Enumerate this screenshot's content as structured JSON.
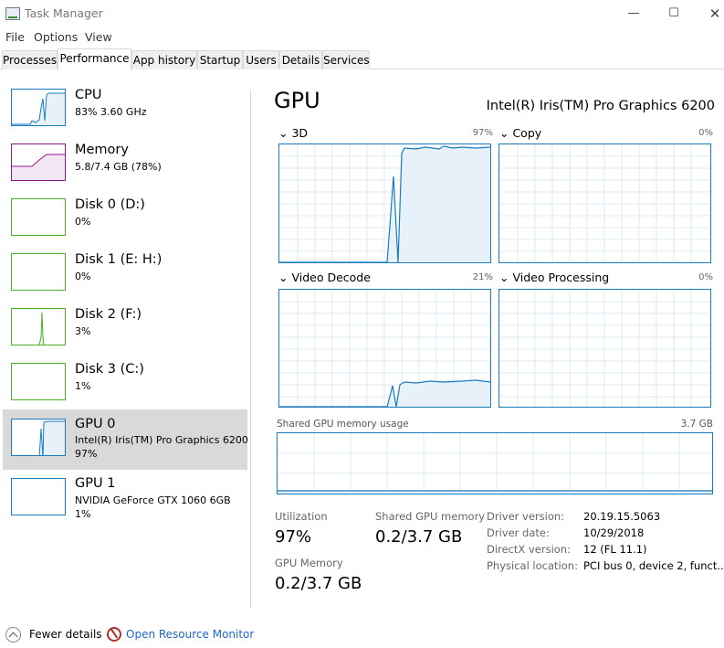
{
  "window": {
    "title": "Task Manager",
    "minimize": "—",
    "maximize": "☐",
    "close": "✕"
  },
  "menu": [
    "File",
    "Options",
    "View"
  ],
  "tabs": [
    "Processes",
    "Performance",
    "App history",
    "Startup",
    "Users",
    "Details",
    "Services"
  ],
  "active_tab": "Performance",
  "colors": {
    "cpu": "#1a7bbf",
    "memory": "#8b1a8b",
    "disk": "#4caf2a",
    "gpu": "#1a7bbf",
    "selected_bg": "#d9d9d9"
  },
  "sidebar": [
    {
      "name": "CPU",
      "sub1": "83% 3.60 GHz",
      "sub2": ""
    },
    {
      "name": "Memory",
      "sub1": "5.8/7.4 GB (78%)",
      "sub2": ""
    },
    {
      "name": "Disk 0 (D:)",
      "sub1": "0%",
      "sub2": ""
    },
    {
      "name": "Disk 1 (E: H:)",
      "sub1": "0%",
      "sub2": ""
    },
    {
      "name": "Disk 2 (F:)",
      "sub1": "3%",
      "sub2": ""
    },
    {
      "name": "Disk 3 (C:)",
      "sub1": "1%",
      "sub2": ""
    },
    {
      "name": "GPU 0",
      "sub1": "Intel(R) Iris(TM) Pro Graphics 6200",
      "sub2": "97%"
    },
    {
      "name": "GPU 1",
      "sub1": "NVIDIA GeForce GTX 1060 6GB",
      "sub2": "1%"
    }
  ],
  "selected_item": "GPU 0",
  "gpu": {
    "title": "GPU",
    "model": "Intel(R) Iris(TM) Pro Graphics 6200",
    "engines": [
      {
        "label": "3D",
        "pct": "97%"
      },
      {
        "label": "Copy",
        "pct": "0%"
      },
      {
        "label": "Video Decode",
        "pct": "21%"
      },
      {
        "label": "Video Processing",
        "pct": "0%"
      }
    ],
    "shared_memory_label": "Shared GPU memory usage",
    "shared_memory_max": "3.7 GB",
    "stats": {
      "utilization_label": "Utilization",
      "utilization": "97%",
      "shared_label": "Shared GPU memory",
      "shared": "0.2/3.7 GB",
      "gpu_memory_label": "GPU Memory",
      "gpu_memory": "0.2/3.7 GB"
    },
    "info": [
      {
        "key": "Driver version:",
        "value": "20.19.15.5063"
      },
      {
        "key": "Driver date:",
        "value": "10/29/2018"
      },
      {
        "key": "DirectX version:",
        "value": "12 (FL 11.1)"
      },
      {
        "key": "Physical location:",
        "value": "PCI bus 0, device 2, funct..."
      }
    ]
  },
  "footer": {
    "fewer_details": "Fewer details",
    "open_resource_monitor": "Open Resource Monitor"
  }
}
